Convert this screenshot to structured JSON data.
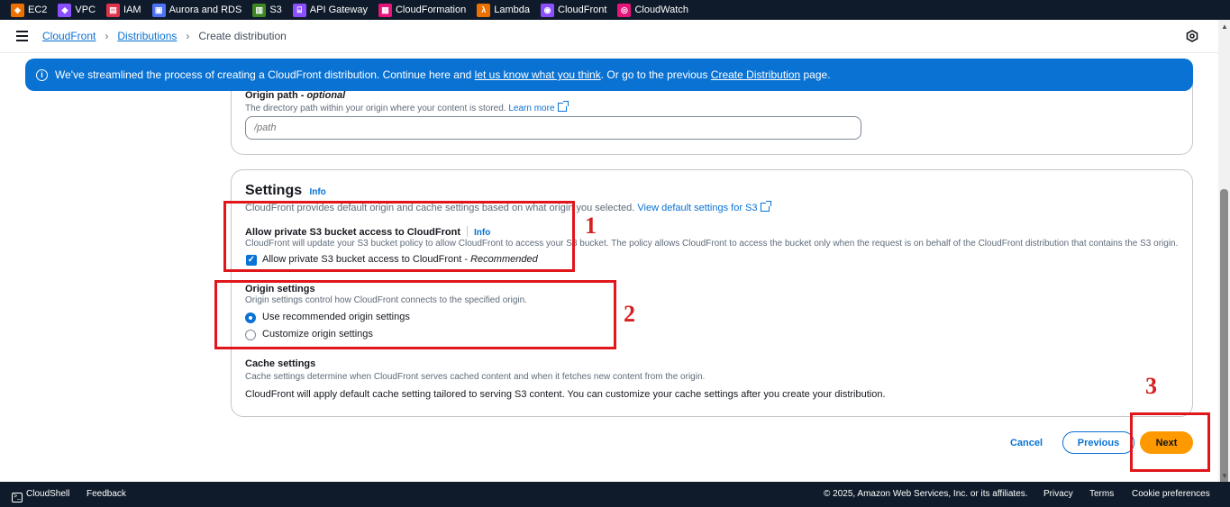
{
  "service_bar": [
    {
      "label": "EC2",
      "icon": "ec2-icon",
      "color": "#ed7100"
    },
    {
      "label": "VPC",
      "icon": "vpc-icon",
      "color": "#8c4fff"
    },
    {
      "label": "IAM",
      "icon": "iam-icon",
      "color": "#dd344c"
    },
    {
      "label": "Aurora and RDS",
      "icon": "rds-icon",
      "color": "#4d72f3"
    },
    {
      "label": "S3",
      "icon": "s3-icon",
      "color": "#3f8624"
    },
    {
      "label": "API Gateway",
      "icon": "api-gateway-icon",
      "color": "#8c4fff"
    },
    {
      "label": "CloudFormation",
      "icon": "cloudformation-icon",
      "color": "#e7157b"
    },
    {
      "label": "Lambda",
      "icon": "lambda-icon",
      "color": "#ed7100"
    },
    {
      "label": "CloudFront",
      "icon": "cloudfront-icon",
      "color": "#8c4fff"
    },
    {
      "label": "CloudWatch",
      "icon": "cloudwatch-icon",
      "color": "#e7157b"
    }
  ],
  "breadcrumb": {
    "items": [
      "CloudFront",
      "Distributions"
    ],
    "current": "Create distribution"
  },
  "banner": {
    "text_before": "We've streamlined the process of creating a CloudFront distribution. Continue here and ",
    "link1": "let us know what you think",
    "text_mid": ". Or go to the previous ",
    "link2": "Create Distribution",
    "text_after": " page."
  },
  "origin_path": {
    "label": "Origin path",
    "optional": " - optional",
    "description": "The directory path within your origin where your content is stored.",
    "learn_more": "Learn more",
    "placeholder": "/path"
  },
  "settings": {
    "title": "Settings",
    "info": "Info",
    "description": "CloudFront provides default origin and cache settings based on what origin you selected.",
    "view_defaults_link": "View default settings for S3",
    "private_bucket": {
      "label": "Allow private S3 bucket access to CloudFront",
      "info": "Info",
      "description": "CloudFront will update your S3 bucket policy to allow CloudFront to access your S3 bucket. The policy allows CloudFront to access the bucket only when the request is on behalf of the CloudFront distribution that contains the S3 origin.",
      "checkbox_label": "Allow private S3 bucket access to CloudFront - ",
      "checkbox_label_em": "Recommended",
      "checked": true
    },
    "origin_settings": {
      "label": "Origin settings",
      "description": "Origin settings control how CloudFront connects to the specified origin.",
      "options": [
        "Use recommended origin settings",
        "Customize origin settings"
      ],
      "selected": "Use recommended origin settings"
    },
    "cache_settings": {
      "label": "Cache settings",
      "description": "Cache settings determine when CloudFront serves cached content and when it fetches new content from the origin.",
      "body": "CloudFront will apply default cache setting tailored to serving S3 content. You can customize your cache settings after you create your distribution."
    }
  },
  "annotations": [
    "1",
    "2",
    "3"
  ],
  "actions": {
    "cancel": "Cancel",
    "previous": "Previous",
    "next": "Next"
  },
  "footer": {
    "cloudshell": "CloudShell",
    "feedback": "Feedback",
    "copyright": "© 2025, Amazon Web Services, Inc. or its affiliates.",
    "privacy": "Privacy",
    "terms": "Terms",
    "cookies": "Cookie preferences"
  },
  "colors": {
    "accent": "#0972d3",
    "primary_button": "#ff9900",
    "annotation": "#e0161b",
    "nav_bg": "#0f1b2a"
  }
}
